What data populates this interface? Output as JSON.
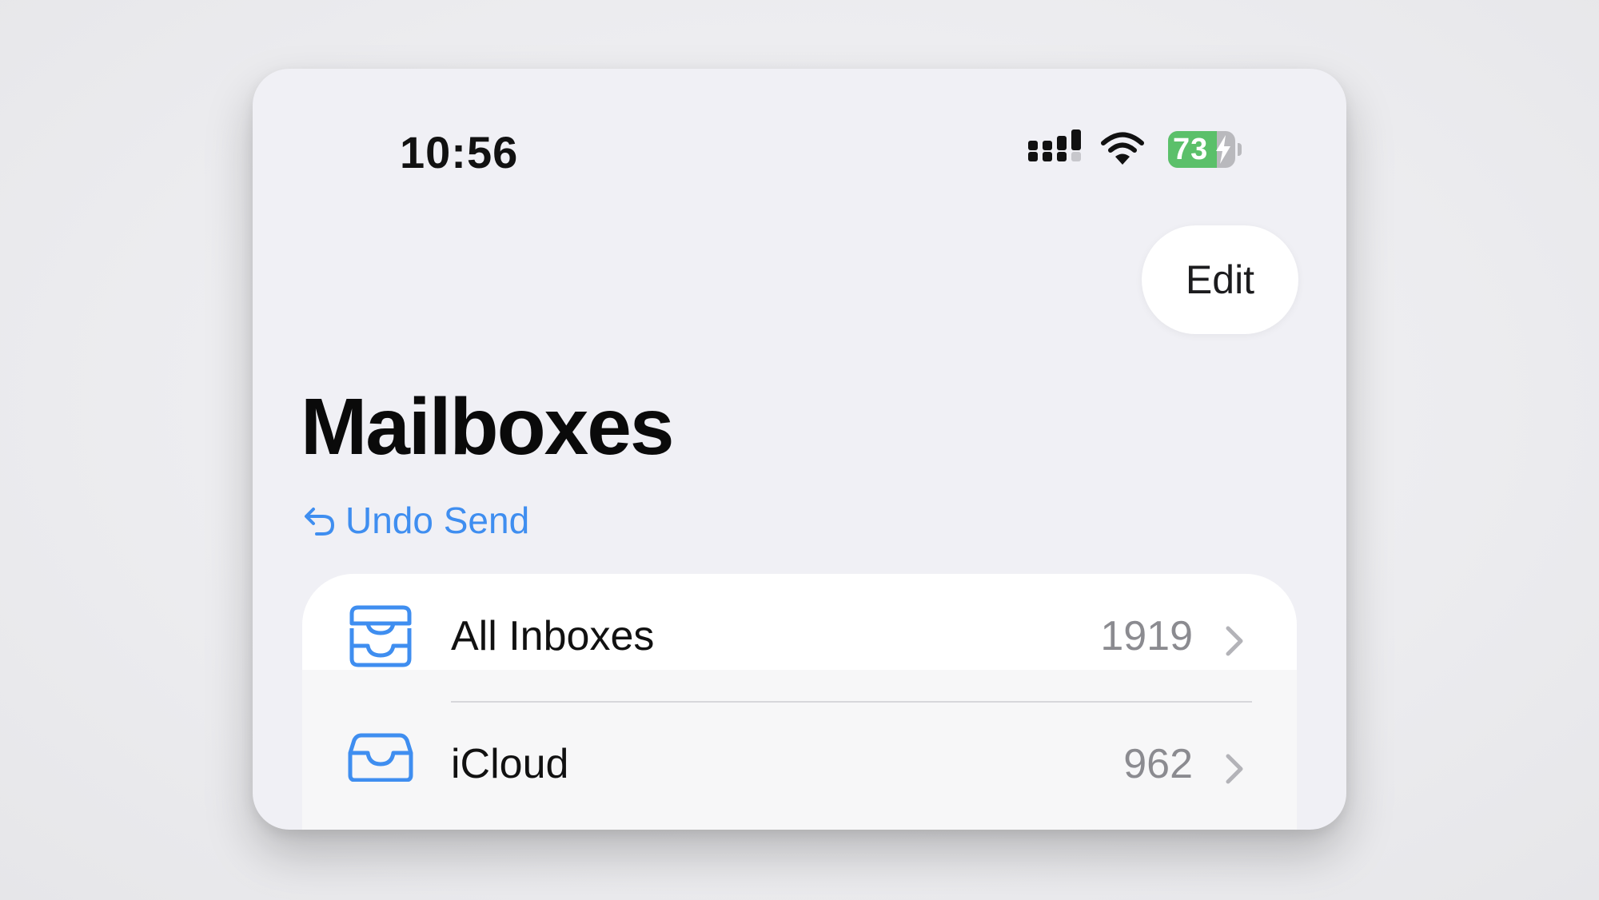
{
  "status_bar": {
    "time": "10:56",
    "battery_text": "73",
    "battery_level": 0.73,
    "charging": true,
    "signal_icon": "cellular-signal-icon",
    "wifi_icon": "wifi-icon"
  },
  "nav": {
    "edit_label": "Edit"
  },
  "header": {
    "title": "Mailboxes",
    "undo_send_label": "Undo Send",
    "undo_icon": "undo-arrow-icon"
  },
  "mailboxes": [
    {
      "label": "All Inboxes",
      "count": "1919",
      "icon": "tray-stack-icon"
    },
    {
      "label": "iCloud",
      "count": "962",
      "icon": "tray-icon"
    }
  ],
  "colors": {
    "accent": "#3f8ef0",
    "battery_green": "#5bc06a",
    "background": "#f0f0f5"
  }
}
